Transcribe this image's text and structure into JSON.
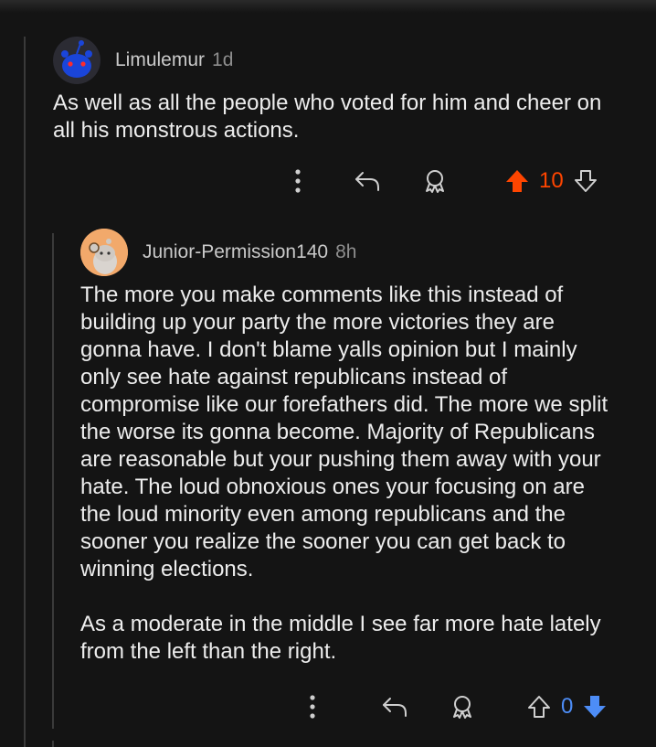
{
  "comments": [
    {
      "username": "Limulemur",
      "age": "1d",
      "body": "As well as all the people who voted for him and cheer on all his monstrous actions.",
      "score": "10",
      "vote_state": "upvoted",
      "upvote_color": "#ff4500",
      "avatar_color": "#1a45d9"
    },
    {
      "username": "Junior-Permission140",
      "age": "8h",
      "body": "The more you make comments like this instead of building up your party the more victories they are gonna have. I don't blame yalls opinion but I mainly only see hate against republicans instead of compromise like our forefathers did. The more we split the worse its gonna become. Majority of Republicans are reasonable but your pushing them away with your hate. The loud obnoxious ones your focusing on are the loud minority even among republicans and the sooner you realize the sooner you can get back to winning elections.\n\nAs a moderate in the middle I see far more hate lately from the left than the right.",
      "score": "0",
      "vote_state": "downvoted",
      "downvote_color": "#4d8df7",
      "avatar_color": "#f2a96b"
    }
  ],
  "icons": {
    "more": "more-options-icon",
    "reply": "reply-icon",
    "award": "award-icon",
    "upvote": "upvote-icon",
    "downvote": "downvote-icon"
  }
}
